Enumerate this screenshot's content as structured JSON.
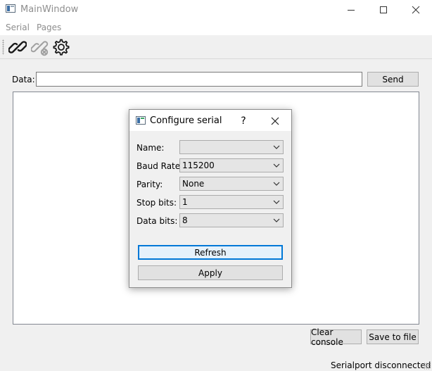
{
  "window": {
    "title": "MainWindow"
  },
  "menubar": {
    "items": [
      "Serial",
      "Pages"
    ]
  },
  "toolbar": {
    "icons": [
      "connect-link-icon",
      "disconnect-link-icon",
      "settings-gear-icon"
    ]
  },
  "data_row": {
    "label": "Data:",
    "input_value": "",
    "send_label": "Send"
  },
  "console": {
    "text": ""
  },
  "bottom_buttons": {
    "clear_label": "Clear console",
    "save_label": "Save to file"
  },
  "status": {
    "text": "Serialport disconnected"
  },
  "dialog": {
    "title": "Configure serial",
    "help_label": "?",
    "fields": [
      {
        "label": "Name:",
        "value": ""
      },
      {
        "label": "Baud Rate:",
        "value": "115200"
      },
      {
        "label": "Parity:",
        "value": "None"
      },
      {
        "label": "Stop bits:",
        "value": "1"
      },
      {
        "label": "Data bits:",
        "value": "8"
      }
    ],
    "refresh_label": "Refresh",
    "apply_label": "Apply"
  },
  "colors": {
    "focus_border": "#0078d7",
    "button_bg": "#e1e1e1",
    "window_bg": "#f0f0f0"
  }
}
